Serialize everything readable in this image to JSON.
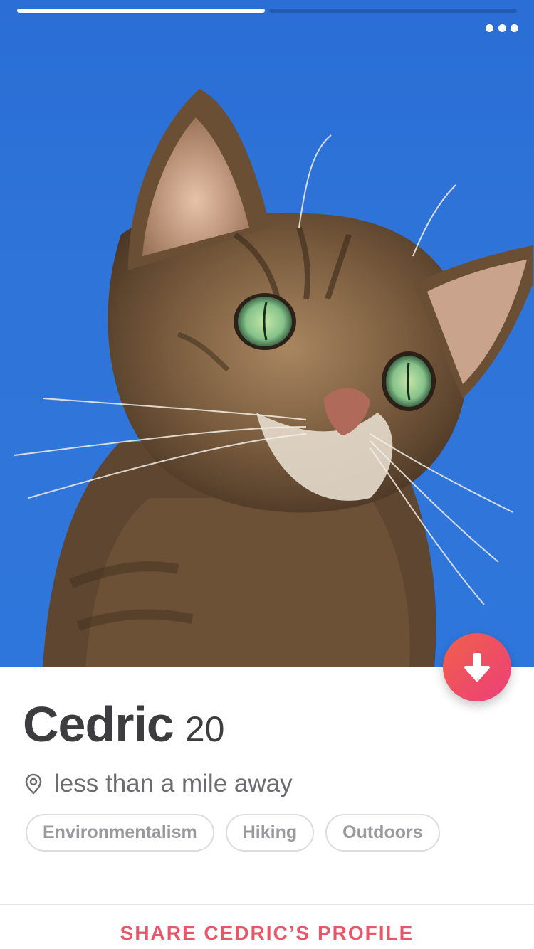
{
  "photo": {
    "subject_icon": "tabby-cat-photo",
    "progress": {
      "segments": 2,
      "active_index": 0
    }
  },
  "menu": {
    "icon": "more-dots-icon"
  },
  "info_button": {
    "icon": "arrow-down-icon"
  },
  "profile": {
    "name": "Cedric",
    "age": "20",
    "distance": "less than a mile away",
    "distance_icon": "location-pin-icon",
    "interests": [
      "Environmentalism",
      "Hiking",
      "Outdoors"
    ]
  },
  "share": {
    "label": "SHARE CEDRIC’S PROFILE"
  },
  "colors": {
    "accent": "#e8566a",
    "fab_start": "#f0604a",
    "fab_end": "#ec3f79",
    "sky": "#2f74d8"
  }
}
